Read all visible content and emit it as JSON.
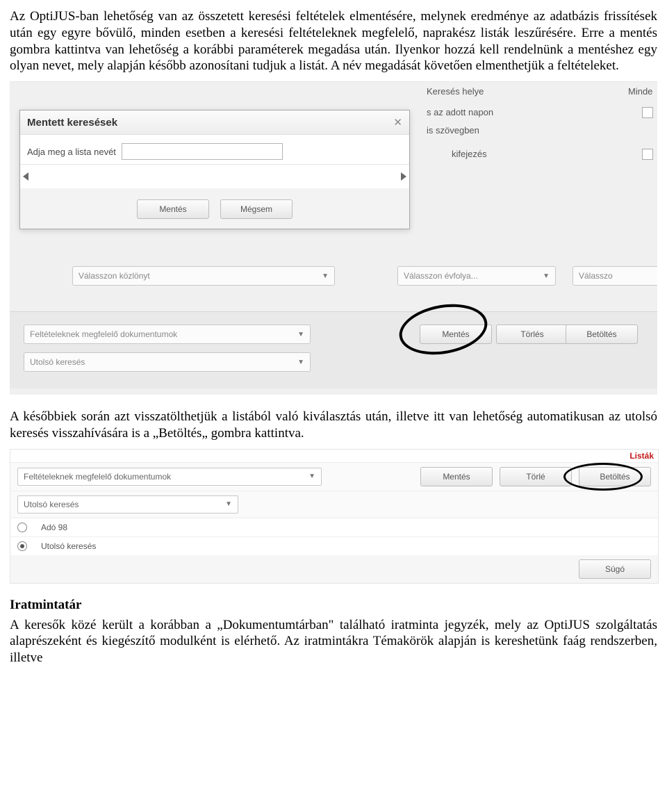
{
  "para1": "Az OptiJUS-ban lehetőség van az összetett keresési feltételek elmentésére, melynek eredménye az adatbázis frissítések után egy egyre bővülő, minden esetben a keresési feltételeknek megfelelő, naprakész listák leszűrésére. Erre a mentés gombra kattintva van lehetőség a korábbi paraméterek megadása után. Ilyenkor hozzá kell rendelnünk a mentéshez egy olyan nevet, mely alapján később azonosítani tudjuk a listát. A név megadását követően elmenthetjük a feltételeket.",
  "para2": "A későbbiek során azt visszatölthetjük a listából való kiválasztás után, illetve itt van lehetőség automatikusan az utolsó keresés visszahívására is a „Betöltés„ gombra kattintva.",
  "heading": "Iratmintatár",
  "para3": "A keresők közé került a korábban a „Dokumentumtárban\" található iratminta jegyzék, mely az OptiJUS szolgáltatás alaprészeként és kiegészítő modulként is elérhető. Az iratmintákra Témakörök alapján is kereshetünk faág rendszerben, illetve",
  "ss1": {
    "bg": {
      "label_kereses_helye": "Keresés helye",
      "label_minde": "Minde",
      "label_adott_napon": "s az adott napon",
      "label_szovegben": "is szövegben",
      "label_kifejezes": "kifejezés",
      "sel_kozlony": "Válasszon közlönyt",
      "sel_evfolya": "Válasszon évfolya...",
      "sel_valasszo": "Válasszo"
    },
    "dialog": {
      "title": "Mentett keresések",
      "prompt": "Adja meg a lista nevét",
      "btn_save": "Mentés",
      "btn_cancel": "Mégsem"
    },
    "lower": {
      "sel_felt": "Feltételeknek megfelelő dokumentumok",
      "sel_utolso": "Utolsó keresés",
      "btn_mentes": "Mentés",
      "btn_torles": "Törlés",
      "btn_betoltes": "Betöltés"
    }
  },
  "ss2": {
    "listak": "Listák",
    "sel_felt": "Feltételeknek megfelelő dokumentumok",
    "sel_utolso": "Utolsó keresés",
    "btn_mentes": "Mentés",
    "btn_torles": "Törlé",
    "btn_betoltes": "Betöltés",
    "opt1": "Adó 98",
    "opt2": "Utolsó keresés",
    "sugo": "Súgó"
  }
}
